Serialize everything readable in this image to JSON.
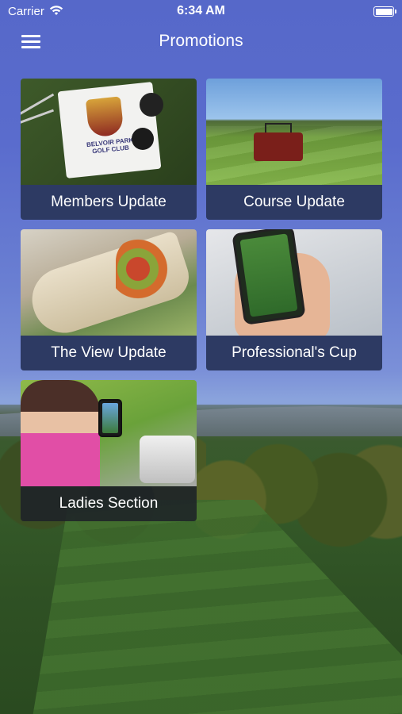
{
  "status_bar": {
    "carrier": "Carrier",
    "time": "6:34 AM"
  },
  "nav": {
    "title": "Promotions"
  },
  "tiles": [
    {
      "label": "Members Update"
    },
    {
      "label": "Course Update"
    },
    {
      "label": "The View Update"
    },
    {
      "label": "Professional's Cup"
    },
    {
      "label": "Ladies Section"
    }
  ],
  "images": {
    "flag_text": "BELVOIR PARK GOLF CLUB"
  },
  "colors": {
    "header_bg": "#5668c9",
    "tile_label_bg": "#2d3a63"
  }
}
